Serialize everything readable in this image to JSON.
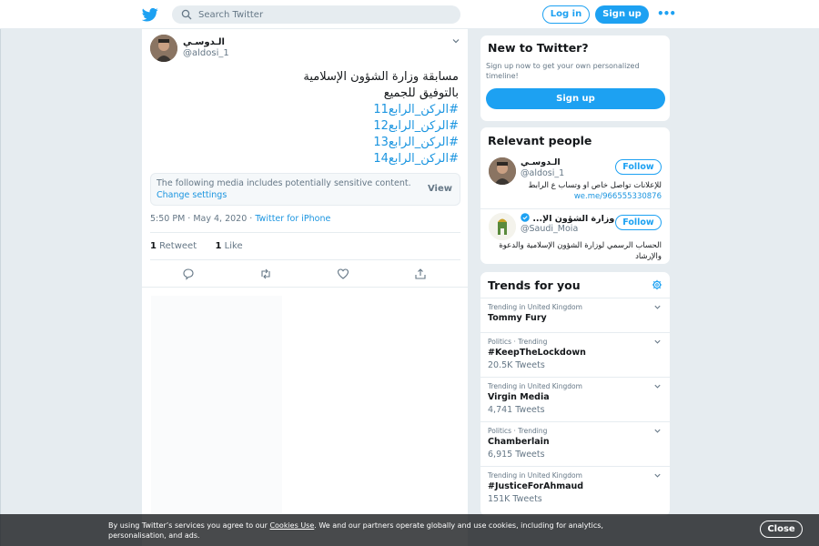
{
  "header": {
    "search_placeholder": "Search Twitter",
    "login_label": "Log in",
    "signup_label": "Sign up",
    "more_label": "•••"
  },
  "tweet": {
    "author_name": "الـدوسـي",
    "author_handle": "@aldosi_1",
    "text_lines": [
      "مسابقة وزارة الشؤون الإسلامية",
      "بالتوفيق للجميع"
    ],
    "hashtags": [
      "#الركن_الرابع11",
      "#الركن_الرابع12",
      "#الركن_الرابع13",
      "#الركن_الرابع14"
    ],
    "media_warning": "The following media includes potentially sensitive content.",
    "change_settings": "Change settings",
    "view_label": "View",
    "time": "5:50 PM · May 4, 2020 · ",
    "source": "Twitter for iPhone",
    "retweet_count": "1",
    "retweet_label": "Retweet",
    "like_count": "1",
    "like_label": "Like"
  },
  "new_to_twitter": {
    "title": "New to Twitter?",
    "description": "Sign up now to get your own personalized timeline!",
    "signup_label": "Sign up"
  },
  "relevant_people": {
    "title": "Relevant people",
    "people": [
      {
        "name": "الـدوسـي",
        "handle": "@aldosi_1",
        "follow_label": "Follow",
        "bio": "للإعلانات تواصل خاص او وتساب ع الرابط",
        "bio_link": "we.me/966555330876"
      },
      {
        "name": "وزارة الشؤون الإ...",
        "handle": "@Saudi_Moia",
        "follow_label": "Follow",
        "bio": "الحساب الرسمي لوزارة الشؤون الإسلامية والدعوة والإرشاد",
        "bio_link": ""
      }
    ]
  },
  "trends": {
    "title": "Trends for you",
    "items": [
      {
        "context": "Trending in United Kingdom",
        "name": "Tommy Fury",
        "count": ""
      },
      {
        "context": "Politics · Trending",
        "name": "#KeepTheLockdown",
        "count": "20.5K Tweets"
      },
      {
        "context": "Trending in United Kingdom",
        "name": "Virgin Media",
        "count": "4,741 Tweets"
      },
      {
        "context": "Politics · Trending",
        "name": "Chamberlain",
        "count": "6,915 Tweets"
      },
      {
        "context": "Trending in United Kingdom",
        "name": "#JusticeForAhmaud",
        "count": "151K Tweets"
      }
    ]
  },
  "cookie_banner": {
    "text_before": "By using Twitter’s services you agree to our ",
    "cookies_link": "Cookies Use",
    "text_after": ". We and our partners operate globally and use cookies, including for analytics, personalisation, and ads.",
    "close_label": "Close"
  },
  "colors": {
    "accent": "#1da1f2",
    "link": "#1b95e0",
    "muted": "#657786",
    "background": "#e6ecf0"
  }
}
